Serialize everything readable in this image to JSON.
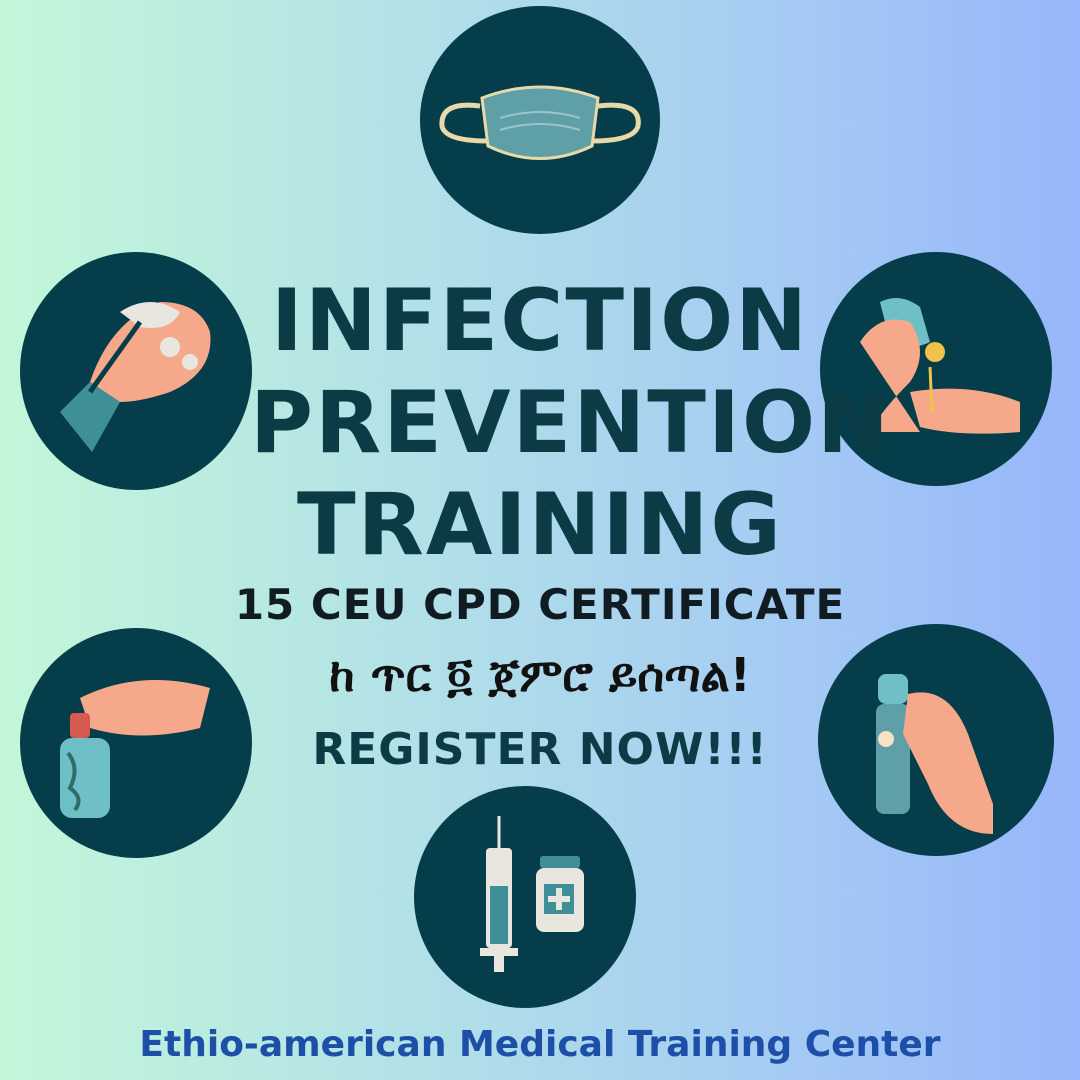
{
  "title": {
    "line1": "INFECTION",
    "line2": "PREVENTION",
    "line3": "TRAINING"
  },
  "subtitle": {
    "certificate": "15 CEU CPD CERTIFICATE",
    "amharic": "ከ ጥር ፬ ጀምሮ ይሰጣል!",
    "cta": "REGISTER NOW!!!"
  },
  "footer": "Ethio-american Medical Training Center",
  "icons": [
    "face-mask-icon",
    "hand-washing-icon",
    "hand-sanitizer-icon",
    "soap-bar-icon",
    "spray-bottle-icon",
    "syringe-vial-icon"
  ],
  "colors": {
    "circle": "#063d4a",
    "title": "#0b3c46",
    "footer": "#1d4fa8",
    "gradient_left": "#c3f7d9",
    "gradient_right": "#97b6fb"
  }
}
